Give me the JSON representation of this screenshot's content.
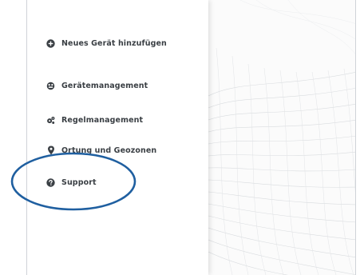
{
  "menu": {
    "items": [
      {
        "label": "Neues Gerät hinzufügen",
        "icon": "plus-circle-icon"
      },
      {
        "label": "Gerätemanagement",
        "icon": "devices-icon"
      },
      {
        "label": "Regelmanagement",
        "icon": "gears-icon"
      },
      {
        "label": "Ortung und Geozonen",
        "icon": "location-pin-icon"
      },
      {
        "label": "Support",
        "icon": "question-circle-icon"
      }
    ]
  },
  "colors": {
    "text": "#3a3f44",
    "annotation": "#1f5fa0",
    "border": "#cfd3d8"
  }
}
